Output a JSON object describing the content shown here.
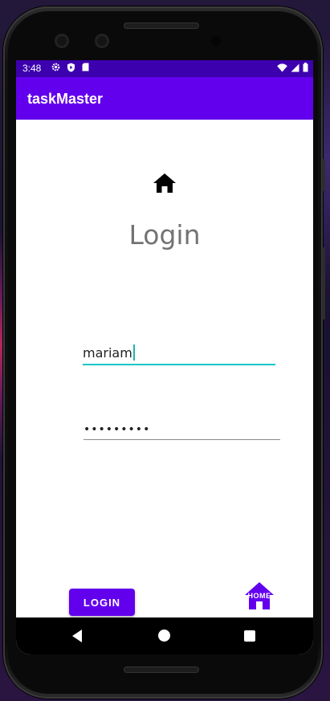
{
  "status_bar": {
    "time": "3:48",
    "icons_left": [
      "gear-icon",
      "shield-play-icon",
      "sd-card-icon"
    ],
    "icons_right": [
      "wifi-icon",
      "signal-icon",
      "battery-icon"
    ]
  },
  "app_bar": {
    "title": "taskMaster"
  },
  "main": {
    "heading": "Login",
    "username_value": "mariam",
    "password_value": "•••••••••",
    "login_button_label": "LOGIN",
    "home_button_label": "HOME",
    "top_icon": "home-icon"
  },
  "nav_bar": {
    "icons": [
      "back-icon",
      "home-circle-icon",
      "recents-icon"
    ]
  },
  "colors": {
    "status_bar": "#3c00ae",
    "primary": "#6200ee",
    "accent": "#19c7c7",
    "heading_text": "#737373"
  }
}
